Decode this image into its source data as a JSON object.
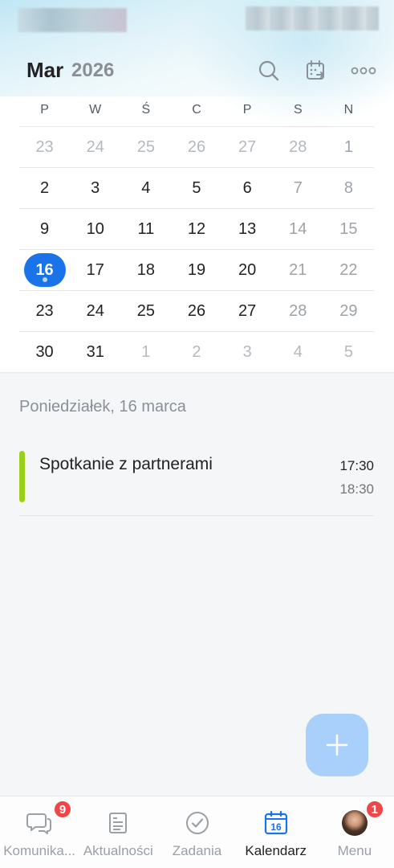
{
  "header": {
    "month": "Mar",
    "year": "2026",
    "icons": [
      "search-icon",
      "calendar-share-icon",
      "more-icon"
    ]
  },
  "weekdays": [
    "P",
    "W",
    "Ś",
    "C",
    "P",
    "S",
    "N"
  ],
  "weeks": [
    [
      {
        "d": "23",
        "muted": true
      },
      {
        "d": "24",
        "muted": true
      },
      {
        "d": "25",
        "muted": true
      },
      {
        "d": "26",
        "muted": true
      },
      {
        "d": "27",
        "muted": true
      },
      {
        "d": "28",
        "muted": true
      },
      {
        "d": "1",
        "weekend": true
      }
    ],
    [
      {
        "d": "2"
      },
      {
        "d": "3"
      },
      {
        "d": "4"
      },
      {
        "d": "5"
      },
      {
        "d": "6"
      },
      {
        "d": "7",
        "weekend": true
      },
      {
        "d": "8",
        "weekend": true
      }
    ],
    [
      {
        "d": "9"
      },
      {
        "d": "10"
      },
      {
        "d": "11"
      },
      {
        "d": "12"
      },
      {
        "d": "13"
      },
      {
        "d": "14",
        "weekend": true
      },
      {
        "d": "15",
        "weekend": true
      }
    ],
    [
      {
        "d": "16",
        "today": true
      },
      {
        "d": "17"
      },
      {
        "d": "18"
      },
      {
        "d": "19"
      },
      {
        "d": "20"
      },
      {
        "d": "21",
        "weekend": true
      },
      {
        "d": "22",
        "weekend": true
      }
    ],
    [
      {
        "d": "23"
      },
      {
        "d": "24"
      },
      {
        "d": "25"
      },
      {
        "d": "26"
      },
      {
        "d": "27"
      },
      {
        "d": "28",
        "weekend": true
      },
      {
        "d": "29",
        "weekend": true
      }
    ],
    [
      {
        "d": "30"
      },
      {
        "d": "31"
      },
      {
        "d": "1",
        "muted": true
      },
      {
        "d": "2",
        "muted": true
      },
      {
        "d": "3",
        "muted": true
      },
      {
        "d": "4",
        "muted": true
      },
      {
        "d": "5",
        "muted": true
      }
    ]
  ],
  "agenda": {
    "date_heading": "Poniedziałek, 16 marca",
    "events": [
      {
        "title": "Spotkanie z partnerami",
        "start": "17:30",
        "end": "18:30",
        "color": "#9bd01a"
      }
    ]
  },
  "fab": {
    "icon": "plus-icon",
    "color": "#a9d0fa"
  },
  "bottom_nav": [
    {
      "label": "Komunika...",
      "icon": "chat-icon",
      "badge": "9",
      "active": false
    },
    {
      "label": "Aktualności",
      "icon": "news-icon",
      "badge": null,
      "active": false
    },
    {
      "label": "Zadania",
      "icon": "check-circle-icon",
      "badge": null,
      "active": false
    },
    {
      "label": "Kalendarz",
      "icon": "calendar-icon",
      "icon_text": "16",
      "badge": null,
      "active": true
    },
    {
      "label": "Menu",
      "icon": "avatar",
      "badge": "1",
      "active": false
    }
  ],
  "colors": {
    "accent": "#1a73e8",
    "badge": "#ef4648"
  }
}
